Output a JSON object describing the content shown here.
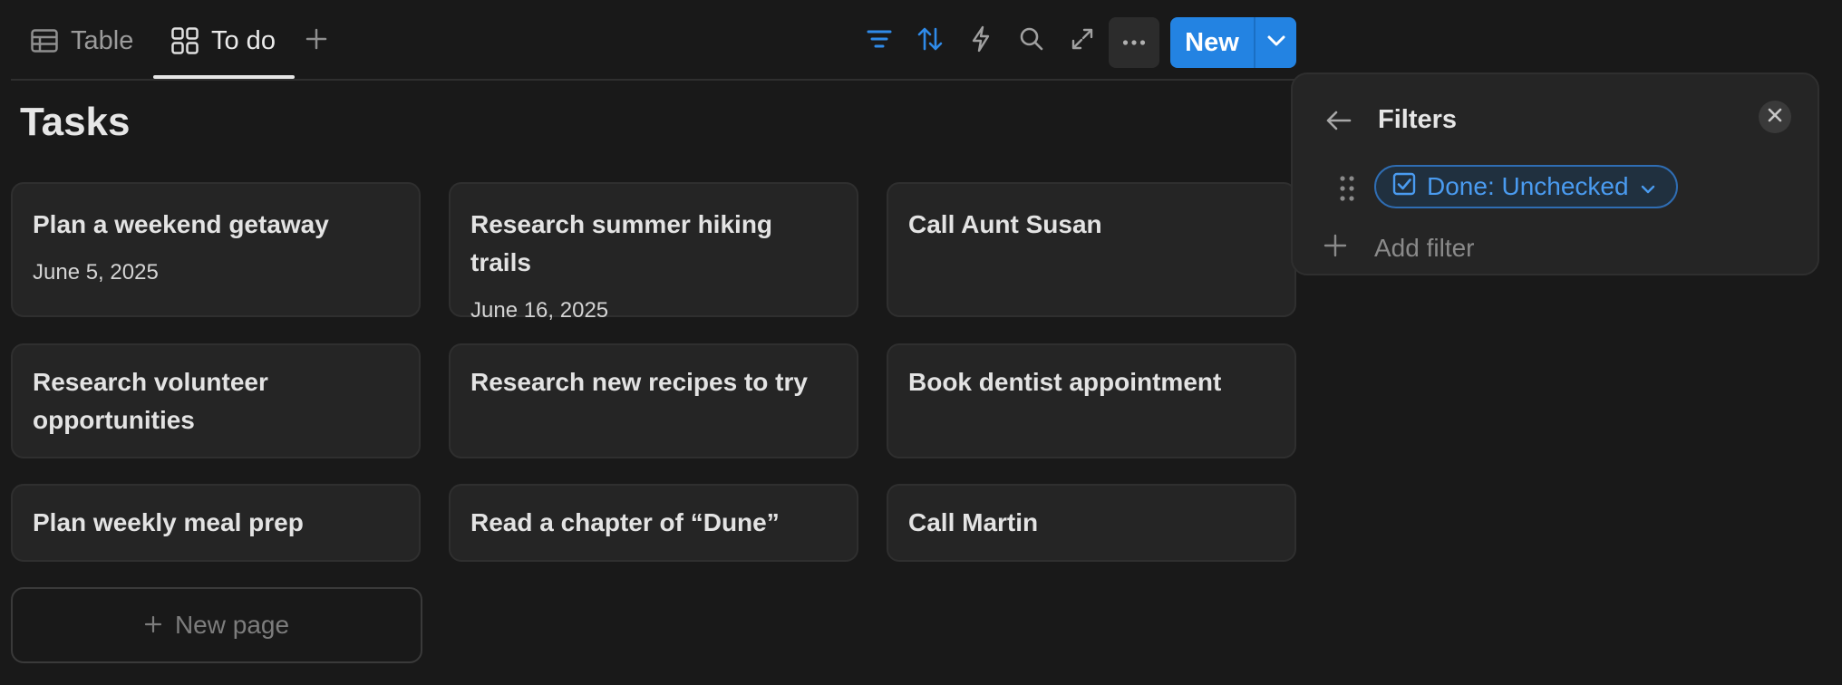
{
  "views": {
    "tabs": [
      {
        "label": "Table",
        "icon": "table-icon"
      },
      {
        "label": "To do",
        "icon": "gallery-icon",
        "active": true
      }
    ],
    "add_icon": "plus-icon"
  },
  "toolbar": {
    "icons": [
      "filter-icon",
      "sort-icon",
      "automation-icon",
      "search-icon",
      "expand-icon",
      "more-icon"
    ],
    "new_label": "New",
    "accent": "#2383e2"
  },
  "page": {
    "title": "Tasks"
  },
  "cards": [
    {
      "title": "Plan a weekend getaway",
      "date": "June 5, 2025"
    },
    {
      "title": "Research summer hiking trails",
      "date": "June 16, 2025"
    },
    {
      "title": "Call Aunt Susan",
      "date": ""
    },
    {
      "title": "Research volunteer opportunities",
      "date": ""
    },
    {
      "title": "Research new recipes to try",
      "date": ""
    },
    {
      "title": "Book dentist appointment",
      "date": ""
    },
    {
      "title": "Plan weekly meal prep",
      "date": ""
    },
    {
      "title": "Read a chapter of “Dune”",
      "date": ""
    },
    {
      "title": "Call Martin",
      "date": ""
    }
  ],
  "new_page_label": "New page",
  "filters": {
    "title": "Filters",
    "chip_label": "Done: Unchecked",
    "chip_color": "#4a9bf0",
    "add_label": "Add filter"
  }
}
